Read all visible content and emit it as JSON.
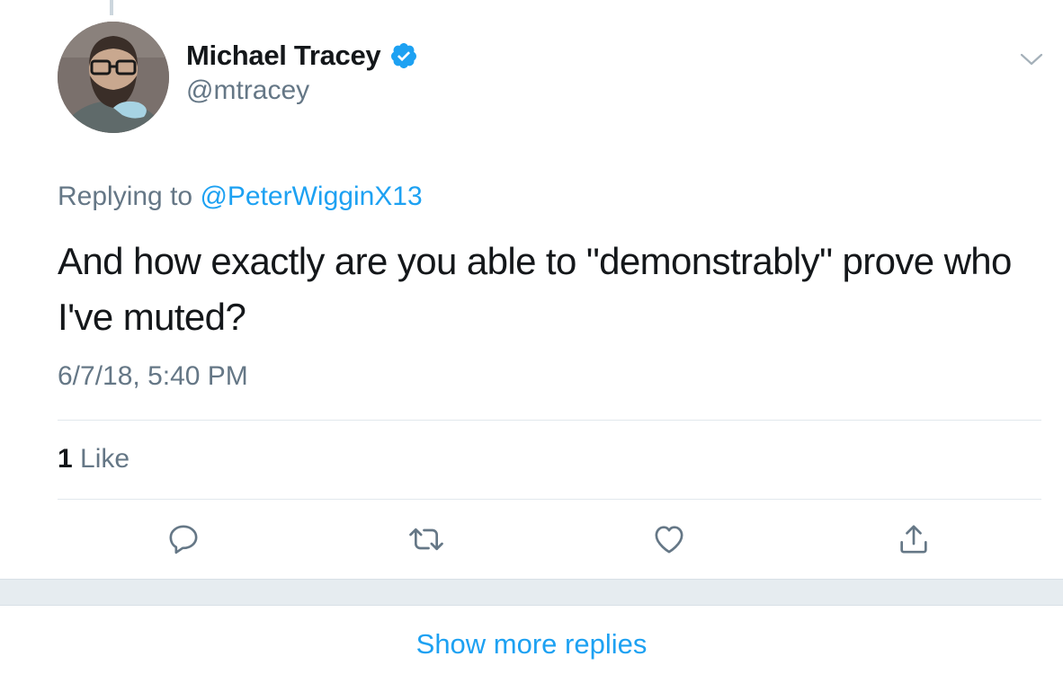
{
  "tweet": {
    "display_name": "Michael Tracey",
    "handle": "@mtracey",
    "verified": true,
    "replying_label": "Replying to",
    "replying_to": "@PeterWigginX13",
    "text": "And how exactly are you able to \"demonstrably\" prove who I've muted?",
    "timestamp": "6/7/18, 5:40 PM",
    "like_count": "1",
    "like_label": "Like"
  },
  "actions": {
    "reply_icon": "reply-icon",
    "retweet_icon": "retweet-icon",
    "like_icon": "heart-icon",
    "share_icon": "share-icon"
  },
  "footer": {
    "show_more_label": "Show more replies"
  },
  "colors": {
    "link": "#1da1f2",
    "secondary_text": "#657786",
    "primary_text": "#14171a",
    "divider": "#e1e8ed",
    "band": "#e6ecf0"
  }
}
